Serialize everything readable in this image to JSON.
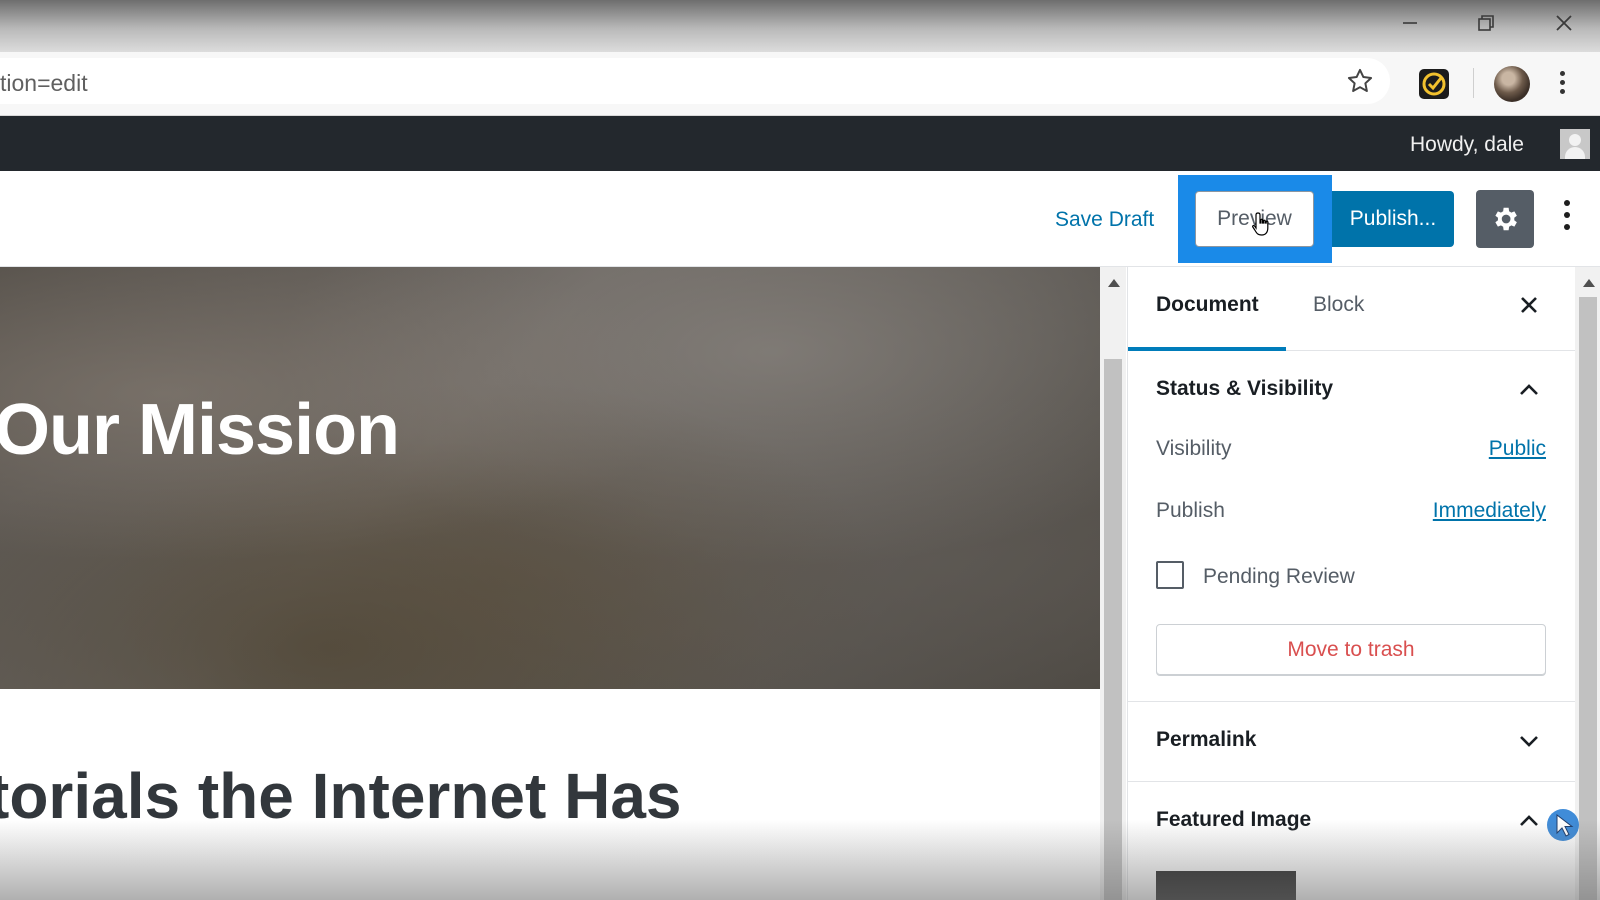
{
  "browser": {
    "url_fragment": "tion=edit"
  },
  "admin_bar": {
    "howdy": "Howdy, dale"
  },
  "editor_header": {
    "save_draft": "Save Draft",
    "preview": "Preview",
    "publish": "Publish..."
  },
  "content": {
    "cover_title": "Our Mission",
    "heading": "torials the Internet Has"
  },
  "sidebar": {
    "tabs": [
      "Document",
      "Block"
    ],
    "status_visibility": {
      "title": "Status & Visibility",
      "visibility_label": "Visibility",
      "visibility_value": "Public",
      "publish_label": "Publish",
      "publish_value": "Immediately",
      "pending_review": "Pending Review",
      "move_to_trash": "Move to trash"
    },
    "permalink": "Permalink",
    "featured_image": "Featured Image"
  },
  "colors": {
    "accent": "#0073aa",
    "highlight": "#1a8ae8",
    "admin_bar": "#23282d",
    "trash": "#d94f4f"
  }
}
